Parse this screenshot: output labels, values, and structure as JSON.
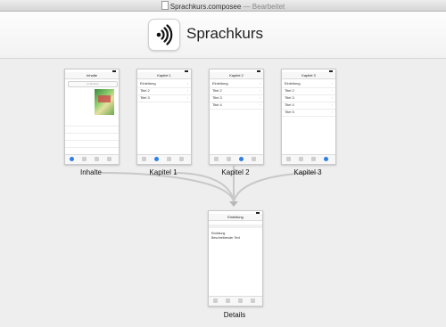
{
  "window": {
    "file_name": "Sprachkurs.composee",
    "separator": "—",
    "status": "Bearbeitet"
  },
  "app": {
    "name": "Sprachkurs",
    "icon": "speaker-waves-icon"
  },
  "screens": {
    "inhalte": {
      "caption": "Inhalte",
      "nav_title": "Inhalte",
      "search_placeholder": "Q Suchen"
    },
    "kapitel1": {
      "caption": "Kapitel 1",
      "nav_title": "Kapitel 1",
      "rows": [
        "Einleitung",
        "Titel 2",
        "Titel 3"
      ]
    },
    "kapitel2": {
      "caption": "Kapitel 2",
      "nav_title": "Kapitel 2",
      "rows": [
        "Einleitung",
        "Titel 2",
        "Titel 3",
        "Titel 4"
      ]
    },
    "kapitel3": {
      "caption": "Kapitel 3",
      "nav_title": "Kapitel 3",
      "rows": [
        "Einleitung",
        "Titel 2",
        "Titel 3",
        "Titel 4",
        "Titel 5"
      ]
    },
    "details": {
      "caption": "Details",
      "nav_title": "Einleitung",
      "heading": "Einleitung",
      "body": "Beschreibender Text"
    }
  },
  "colors": {
    "accent": "#2f7fe6",
    "connector": "#c8c8c8"
  }
}
